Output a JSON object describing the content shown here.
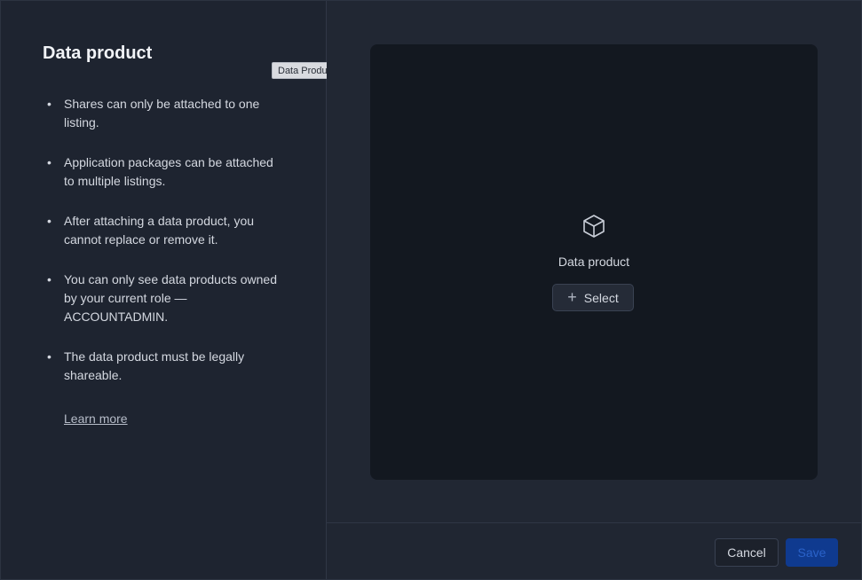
{
  "left": {
    "title": "Data product",
    "bullets": [
      "Shares can only be attached to one listing.",
      "Application packages can be attached to multiple listings.",
      "After attaching a data product, you cannot replace or remove it.",
      "You can only see data products owned by your current role — ACCOUNTADMIN.",
      "The data product must be legally shareable."
    ],
    "learn_more": "Learn more"
  },
  "tooltip": "Data Product",
  "drop_area": {
    "icon": "cube-icon",
    "label": "Data product",
    "select_label": "Select"
  },
  "footer": {
    "cancel_label": "Cancel",
    "save_label": "Save"
  },
  "colors": {
    "save_bg": "#0f3a8f",
    "save_text": "#2a62c9",
    "drop_area_bg": "#131820"
  }
}
